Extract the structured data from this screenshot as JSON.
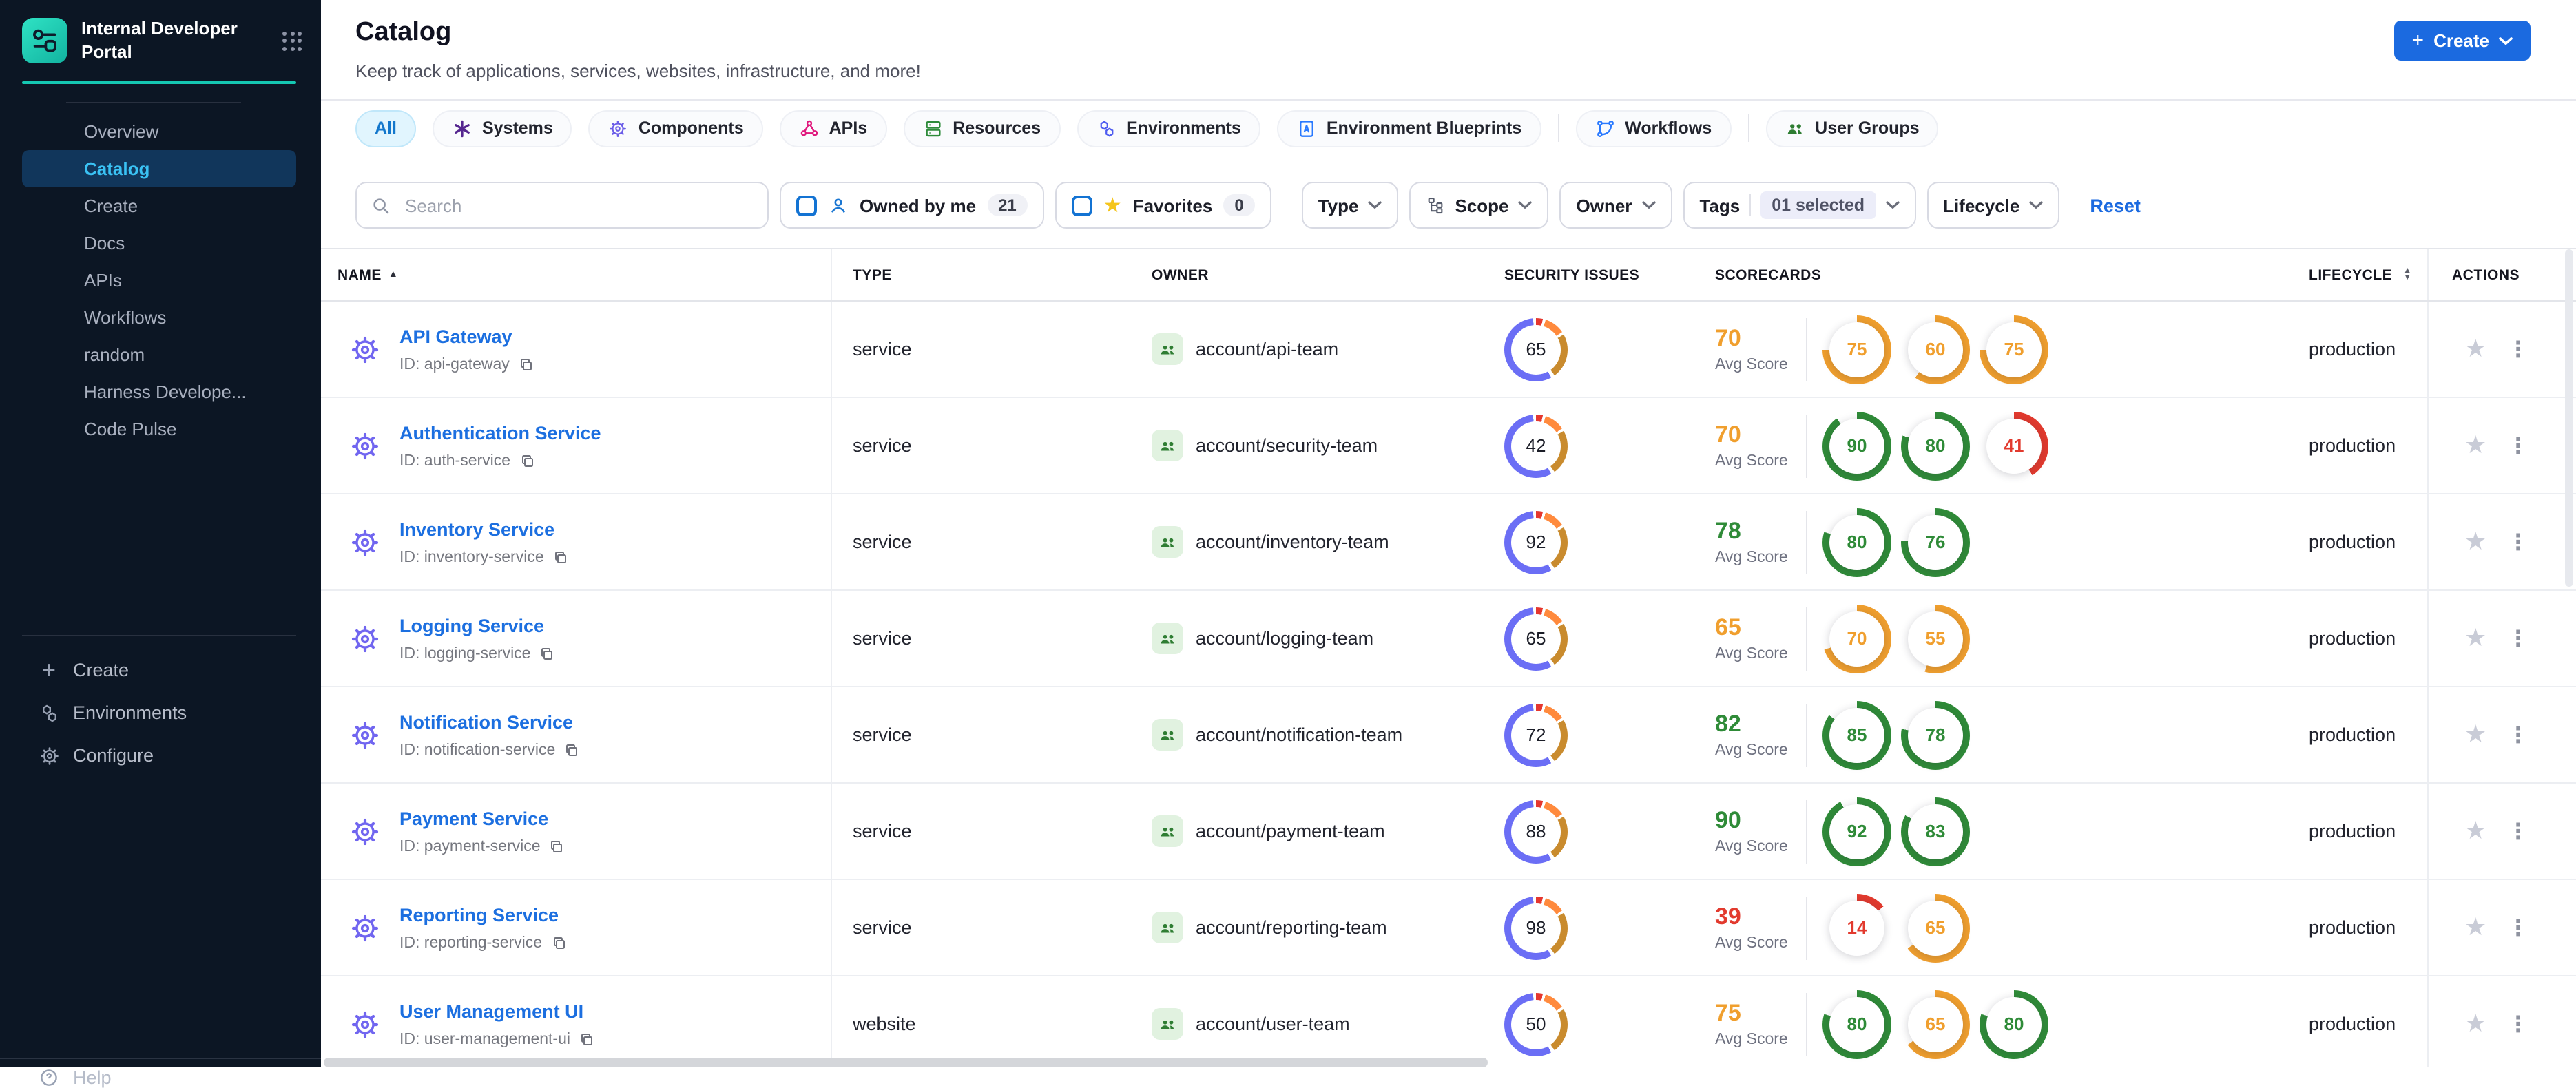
{
  "brand": {
    "title": "Internal Developer Portal"
  },
  "sidebar": {
    "nav": [
      {
        "label": "Overview",
        "active": false
      },
      {
        "label": "Catalog",
        "active": true
      },
      {
        "label": "Create",
        "active": false
      },
      {
        "label": "Docs",
        "active": false
      },
      {
        "label": "APIs",
        "active": false
      },
      {
        "label": "Workflows",
        "active": false
      },
      {
        "label": "random",
        "active": false
      },
      {
        "label": "Harness Develope...",
        "active": false
      },
      {
        "label": "Code Pulse",
        "active": false
      }
    ],
    "footer_nav": [
      {
        "label": "Create",
        "icon": "plus-icon"
      },
      {
        "label": "Environments",
        "icon": "hexagons-icon"
      },
      {
        "label": "Configure",
        "icon": "gear-icon"
      }
    ],
    "help_label": "Help"
  },
  "header": {
    "title": "Catalog",
    "subtitle": "Keep track of applications, services, websites, infrastructure, and more!",
    "create_button_label": "Create"
  },
  "tabs": [
    {
      "label": "All",
      "active": true,
      "icon": null,
      "color": null,
      "divider_before": false
    },
    {
      "label": "Systems",
      "active": false,
      "icon": "systems-icon",
      "color": "#55268f",
      "divider_before": false
    },
    {
      "label": "Components",
      "active": false,
      "icon": "components-gear-icon",
      "color": "#6b5de8",
      "divider_before": false
    },
    {
      "label": "APIs",
      "active": false,
      "icon": "apis-icon",
      "color": "#e0187d",
      "divider_before": false
    },
    {
      "label": "Resources",
      "active": false,
      "icon": "resources-icon",
      "color": "#2e8b3a",
      "divider_before": false
    },
    {
      "label": "Environments",
      "active": false,
      "icon": "environments-icon",
      "color": "#4d5bf0",
      "divider_before": false
    },
    {
      "label": "Environment Blueprints",
      "active": false,
      "icon": "blueprints-icon",
      "color": "#2979ff",
      "divider_before": false
    },
    {
      "label": "Workflows",
      "active": false,
      "icon": "workflows-icon",
      "color": "#2979ff",
      "divider_before": true
    },
    {
      "label": "User Groups",
      "active": false,
      "icon": "user-groups-icon",
      "color": "#2e7d32",
      "divider_before": true
    }
  ],
  "filters": {
    "search_placeholder": "Search",
    "owned_by_me": {
      "label": "Owned by me",
      "count": "21"
    },
    "favorites": {
      "label": "Favorites",
      "count": "0"
    },
    "type_label": "Type",
    "scope_label": "Scope",
    "owner_label": "Owner",
    "tags_label": "Tags",
    "tags_value": "01 selected",
    "lifecycle_label": "Lifecycle",
    "reset_label": "Reset"
  },
  "table": {
    "columns": {
      "name": "NAME",
      "type": "TYPE",
      "owner": "OWNER",
      "security": "SECURITY ISSUES",
      "scorecards": "SCORECARDS",
      "lifecycle": "LIFECYCLE",
      "actions": "ACTIONS"
    },
    "avg_score_label": "Avg Score",
    "rows": [
      {
        "name": "API Gateway",
        "id": "ID: api-gateway",
        "type": "service",
        "owner": "account/api-team",
        "security_issues": 65,
        "avg_score": 70,
        "scores": [
          75,
          60,
          75
        ],
        "lifecycle": "production"
      },
      {
        "name": "Authentication Service",
        "id": "ID: auth-service",
        "type": "service",
        "owner": "account/security-team",
        "security_issues": 42,
        "avg_score": 70,
        "scores": [
          90,
          80,
          41
        ],
        "lifecycle": "production"
      },
      {
        "name": "Inventory Service",
        "id": "ID: inventory-service",
        "type": "service",
        "owner": "account/inventory-team",
        "security_issues": 92,
        "avg_score": 78,
        "scores": [
          80,
          76
        ],
        "lifecycle": "production"
      },
      {
        "name": "Logging Service",
        "id": "ID: logging-service",
        "type": "service",
        "owner": "account/logging-team",
        "security_issues": 65,
        "avg_score": 65,
        "scores": [
          70,
          55
        ],
        "lifecycle": "production"
      },
      {
        "name": "Notification Service",
        "id": "ID: notification-service",
        "type": "service",
        "owner": "account/notification-team",
        "security_issues": 72,
        "avg_score": 82,
        "scores": [
          85,
          78
        ],
        "lifecycle": "production"
      },
      {
        "name": "Payment Service",
        "id": "ID: payment-service",
        "type": "service",
        "owner": "account/payment-team",
        "security_issues": 88,
        "avg_score": 90,
        "scores": [
          92,
          83
        ],
        "lifecycle": "production"
      },
      {
        "name": "Reporting Service",
        "id": "ID: reporting-service",
        "type": "service",
        "owner": "account/reporting-team",
        "security_issues": 98,
        "avg_score": 39,
        "scores": [
          14,
          65
        ],
        "lifecycle": "production"
      },
      {
        "name": "User Management UI",
        "id": "ID: user-management-ui",
        "type": "website",
        "owner": "account/user-team",
        "security_issues": 50,
        "avg_score": 75,
        "scores": [
          80,
          65,
          80
        ],
        "lifecycle": "production"
      }
    ]
  },
  "colors": {
    "score_green": "#2f8b38",
    "score_orange": "#f09f2e",
    "score_red": "#e23a2e",
    "accent_blue": "#1b6ae0",
    "teal": "#15c7b2"
  }
}
